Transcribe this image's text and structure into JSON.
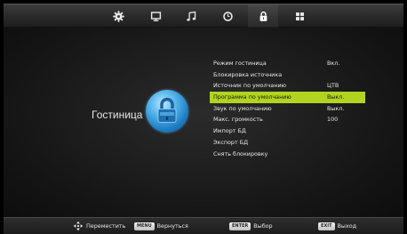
{
  "tabs": [
    {
      "icon": "gear-icon",
      "active": false
    },
    {
      "icon": "monitor-icon",
      "active": false
    },
    {
      "icon": "music-note-icon",
      "active": false
    },
    {
      "icon": "clock-icon",
      "active": false
    },
    {
      "icon": "lock-icon",
      "active": true
    },
    {
      "icon": "grid-icon",
      "active": false
    }
  ],
  "section": {
    "title": "Гостиница",
    "emblem_icon": "lock-icon"
  },
  "menu": {
    "items": [
      {
        "label": "Режим гостиница",
        "value": "Вкл."
      },
      {
        "label": "Блокировка источника",
        "value": ""
      },
      {
        "label": "Источник по умолчанию",
        "value": "ЦТВ"
      },
      {
        "label": "Программа по умолчанию",
        "value": "Выкл.",
        "highlighted": true
      },
      {
        "label": "Звук по умолчанию",
        "value": "Выкл."
      },
      {
        "label": "Макс. громкость",
        "value": "100"
      },
      {
        "label": "Импорт БД",
        "value": ""
      },
      {
        "label": "Экспорт БД",
        "value": ""
      },
      {
        "label": "Снять блокировку",
        "value": ""
      }
    ]
  },
  "help": {
    "move_label": "Переместить",
    "menu_key": "MENU",
    "back_label": "Вернуться",
    "enter_key": "ENTER",
    "select_label": "Выбор",
    "exit_key": "EXIT",
    "exit_label": "Выход"
  },
  "colors": {
    "highlight": "#b2d420",
    "emblem": "#3aa0e0"
  }
}
